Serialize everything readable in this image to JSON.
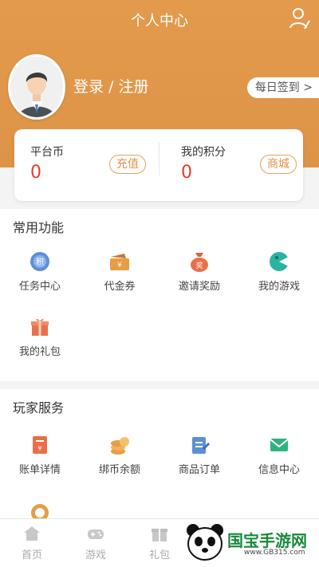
{
  "header": {
    "title": "个人中心",
    "login_text": "登录 / 注册",
    "checkin": "每日签到 >"
  },
  "account": {
    "coins": {
      "label": "平台币",
      "value": "0",
      "action": "充值"
    },
    "points": {
      "label": "我的积分",
      "value": "0",
      "action": "商城"
    }
  },
  "common": {
    "title": "常用功能",
    "items": [
      {
        "label": "任务中心",
        "icon": "points-badge-icon"
      },
      {
        "label": "代金券",
        "icon": "voucher-icon"
      },
      {
        "label": "邀请奖励",
        "icon": "reward-bag-icon"
      },
      {
        "label": "我的游戏",
        "icon": "game-icon"
      },
      {
        "label": "我的礼包",
        "icon": "gift-icon"
      }
    ]
  },
  "services": {
    "title": "玩家服务",
    "items": [
      {
        "label": "账单详情",
        "icon": "bill-icon"
      },
      {
        "label": "绑币余额",
        "icon": "coin-stack-icon"
      },
      {
        "label": "商品订单",
        "icon": "order-icon"
      },
      {
        "label": "信息中心",
        "icon": "mail-icon"
      }
    ]
  },
  "tabbar": {
    "items": [
      {
        "label": "首页"
      },
      {
        "label": "游戏"
      },
      {
        "label": "礼包"
      }
    ]
  },
  "watermark": {
    "name": "国宝手游网",
    "url": "www.GB315.com"
  },
  "colors": {
    "accent": "#E39A4C",
    "value_red": "#E43D2C",
    "section_bg": "#FFFFFF",
    "page_bg": "#F4F4F4"
  }
}
